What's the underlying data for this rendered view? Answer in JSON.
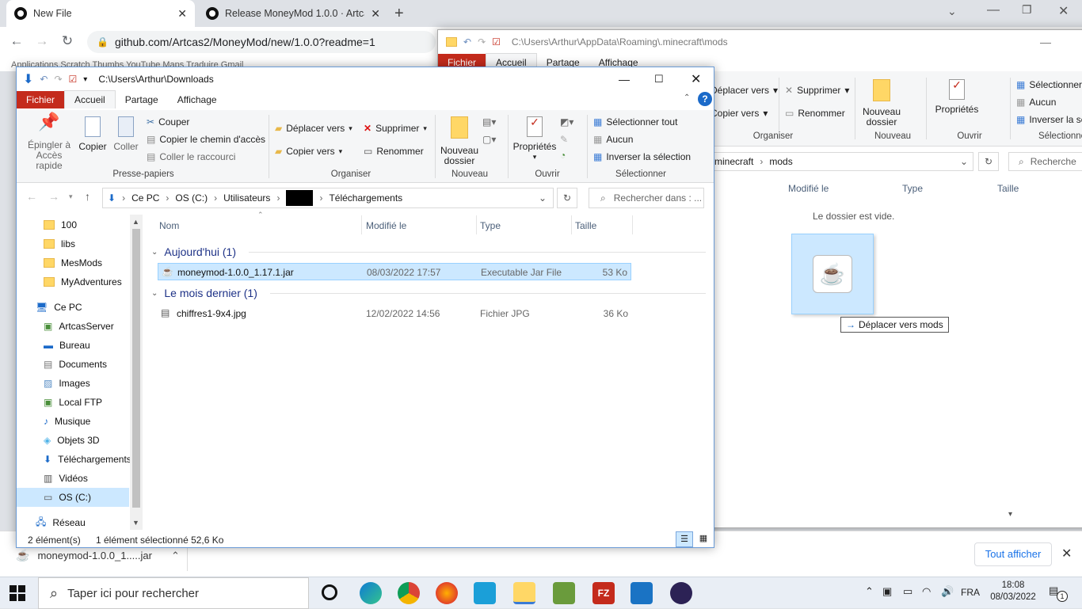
{
  "browser": {
    "tabs": [
      {
        "label": "New File"
      },
      {
        "label": "Release MoneyMod 1.0.0 · Artca"
      }
    ],
    "url": "github.com/Artcas2/MoneyMod/new/1.0.0?readme=1",
    "bookmarks": "Applications   Scratch Thumbs   YouTube   Maps   Traduire   Gmail",
    "download_shelf": {
      "file": "moneymod-1.0.0_1.....jar",
      "show_all": "Tout afficher"
    }
  },
  "explorer_back": {
    "path": "C:\\Users\\Arthur\\AppData\\Roaming\\.minecraft\\mods",
    "tabs": [
      "Fichier",
      "Accueil",
      "Partage",
      "Affichage"
    ],
    "ribbon": {
      "move_to": "Déplacer vers",
      "copy_to": "Copier vers",
      "delete": "Supprimer",
      "rename": "Renommer",
      "new_folder": "Nouveau dossier",
      "properties": "Propriétés",
      "select_all": "Sélectionner",
      "none": "Aucun",
      "invert": "Inverser la sé",
      "groups": [
        "Organiser",
        "Nouveau",
        "Ouvrir",
        "Sélectionne"
      ]
    },
    "breadcrumb": [
      "minecraft",
      "mods"
    ],
    "search_placeholder": "Recherche",
    "columns": [
      "Modifié le",
      "Type",
      "Taille"
    ],
    "empty_text": "Le dossier est vide.",
    "drag_tooltip": "Déplacer vers mods"
  },
  "explorer_front": {
    "path": "C:\\Users\\Arthur\\Downloads",
    "tabs": [
      "Fichier",
      "Accueil",
      "Partage",
      "Affichage"
    ],
    "ribbon": {
      "pin": "Épingler à Accès rapide",
      "copy": "Copier",
      "paste": "Coller",
      "cut": "Couper",
      "copy_path": "Copier le chemin d'accès",
      "paste_shortcut": "Coller le raccourci",
      "clipboard_group": "Presse-papiers",
      "move_to": "Déplacer vers",
      "copy_to": "Copier vers",
      "delete": "Supprimer",
      "rename": "Renommer",
      "organize_group": "Organiser",
      "new_folder": "Nouveau dossier",
      "new_group": "Nouveau",
      "properties": "Propriétés",
      "open_group": "Ouvrir",
      "select_all": "Sélectionner tout",
      "none": "Aucun",
      "invert": "Inverser la sélection",
      "select_group": "Sélectionner"
    },
    "breadcrumb": [
      "Ce PC",
      "OS (C:)",
      "Utilisateurs",
      "Téléchargements"
    ],
    "search_placeholder": "Rechercher dans : ...",
    "nav": [
      {
        "label": "100",
        "icon": "folder-icon"
      },
      {
        "label": "libs",
        "icon": "folder-icon"
      },
      {
        "label": "MesMods",
        "icon": "folder-icon"
      },
      {
        "label": "MyAdventures",
        "icon": "folder-icon"
      },
      {
        "label": "Ce PC",
        "icon": "pc-icon"
      },
      {
        "label": "ArtcasServer",
        "icon": "network-drive-icon"
      },
      {
        "label": "Bureau",
        "icon": "desktop-icon"
      },
      {
        "label": "Documents",
        "icon": "documents-icon"
      },
      {
        "label": "Images",
        "icon": "images-icon"
      },
      {
        "label": "Local FTP",
        "icon": "ftp-icon"
      },
      {
        "label": "Musique",
        "icon": "music-icon"
      },
      {
        "label": "Objets 3D",
        "icon": "objects3d-icon"
      },
      {
        "label": "Téléchargements",
        "icon": "downloads-icon"
      },
      {
        "label": "Vidéos",
        "icon": "videos-icon"
      },
      {
        "label": "OS (C:)",
        "icon": "drive-icon"
      },
      {
        "label": "Réseau",
        "icon": "network-icon"
      }
    ],
    "columns": [
      "Nom",
      "Modifié le",
      "Type",
      "Taille"
    ],
    "groups": [
      {
        "title": "Aujourd'hui (1)",
        "files": [
          {
            "name": "moneymod-1.0.0_1.17.1.jar",
            "date": "08/03/2022 17:57",
            "type": "Executable Jar File",
            "size": "53 Ko"
          }
        ]
      },
      {
        "title": "Le mois dernier (1)",
        "files": [
          {
            "name": "chiffres1-9x4.jpg",
            "date": "12/02/2022 14:56",
            "type": "Fichier JPG",
            "size": "36 Ko"
          }
        ]
      }
    ],
    "status": {
      "count": "2 élément(s)",
      "selected": "1 élément sélectionné  52,6 Ko"
    }
  },
  "taskbar": {
    "search_placeholder": "Taper ici pour rechercher",
    "language": "FRA",
    "time": "18:08",
    "date": "08/03/2022",
    "notifications": "1"
  }
}
